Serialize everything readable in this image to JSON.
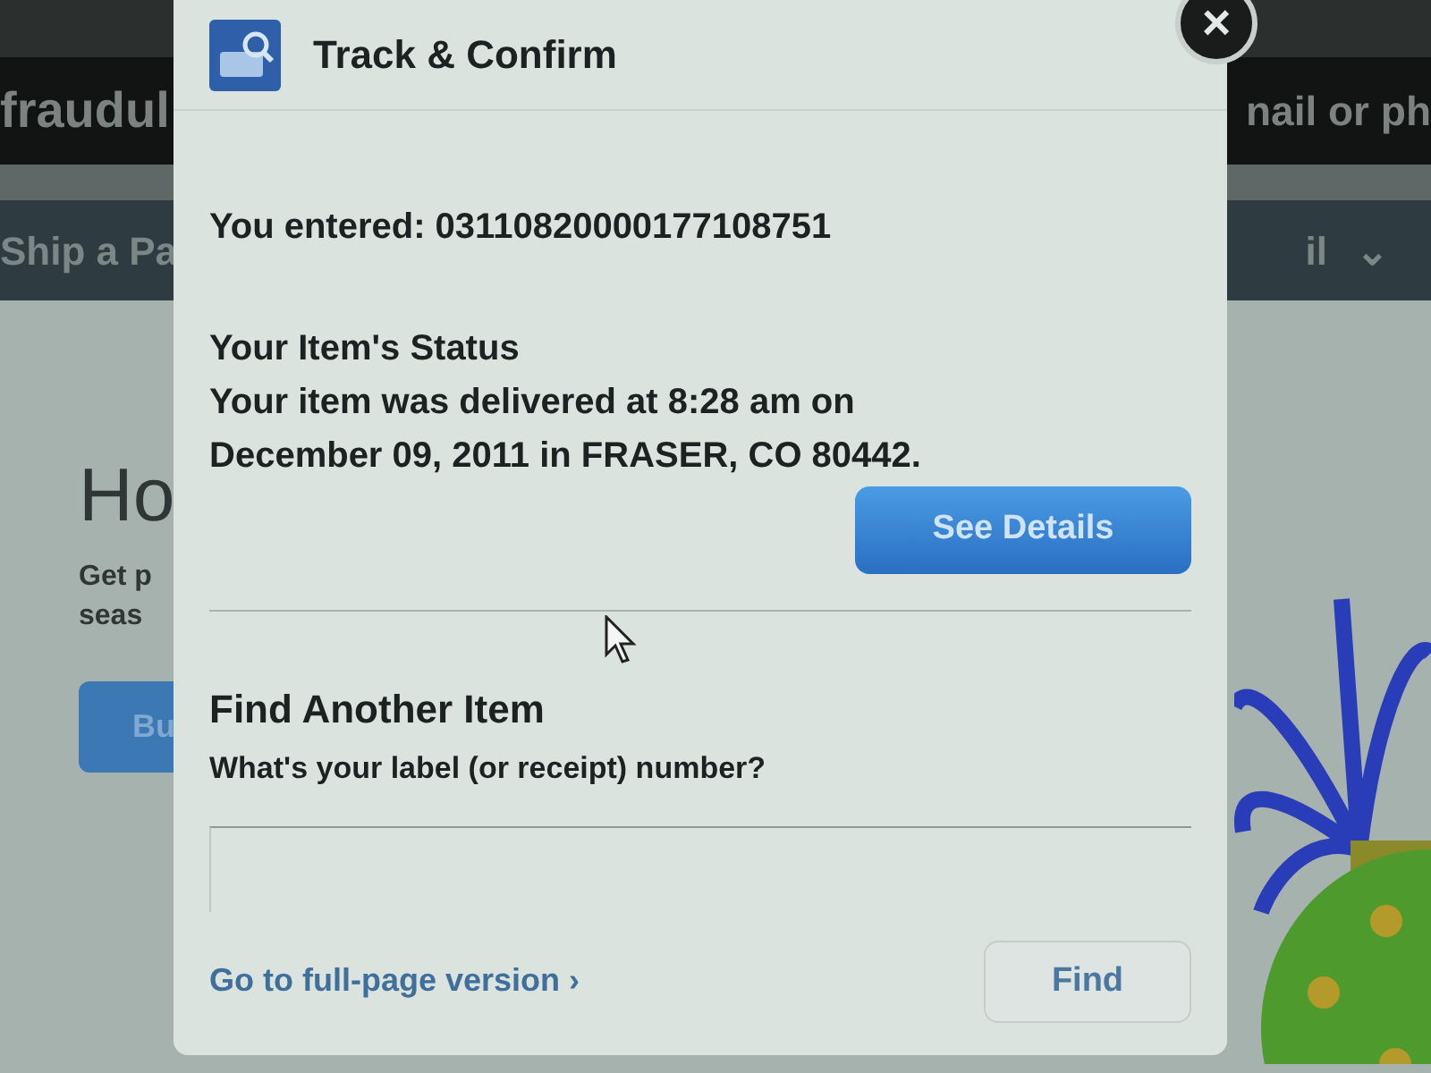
{
  "background_page": {
    "top_bar": {
      "left_text": "fraudul",
      "right_text": "nail or ph"
    },
    "nav": {
      "left_item": "Ship a Pa",
      "right_item": "il",
      "right_caret": "⌄"
    },
    "hero": {
      "heading": "Ho",
      "text_lines": [
        "Get p",
        "seas"
      ],
      "button": "Bu"
    }
  },
  "dialog": {
    "title": "Track & Confirm",
    "close": "×",
    "entered": "You entered: 03110820000177108751",
    "status_heading": "Your Item's Status",
    "status_lines": [
      "Your item was delivered at 8:28 am on",
      "December 09, 2011 in FRASER, CO 80442."
    ],
    "details_button": "See Details",
    "find_heading": "Find Another Item",
    "find_prompt": "What's your label (or receipt) number?",
    "full_page_link": "Go to full-page version ›",
    "find_button": "Find"
  }
}
